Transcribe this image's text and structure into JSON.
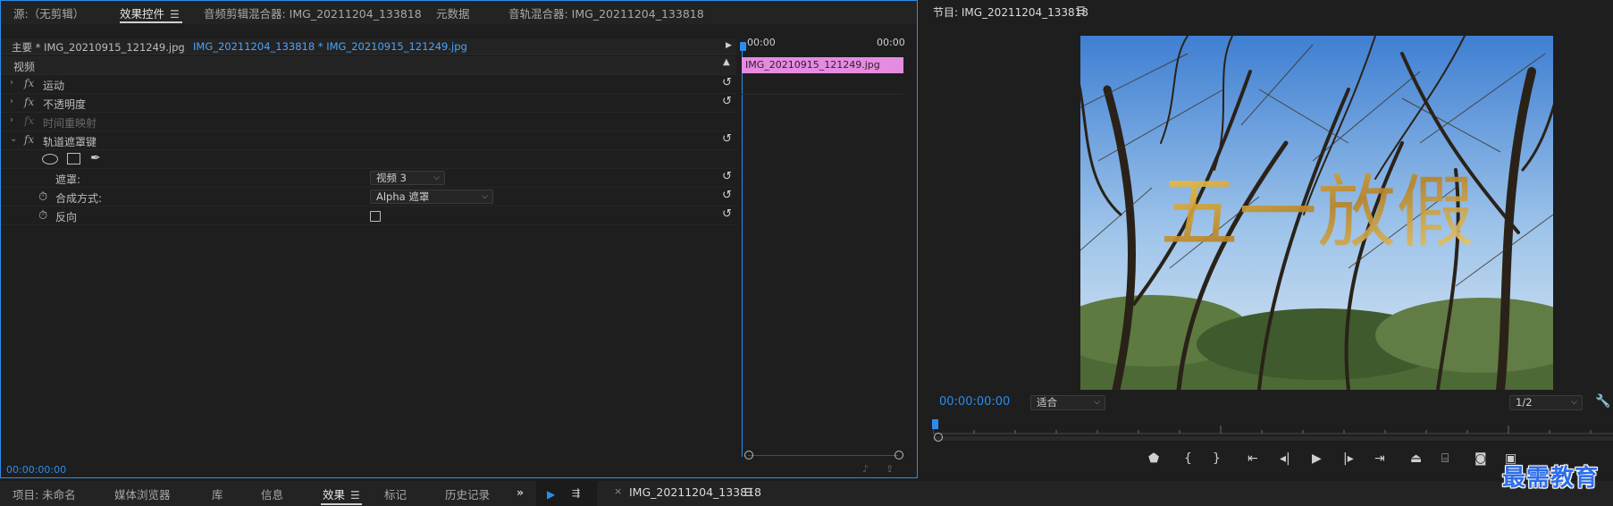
{
  "top_tabs": {
    "source": "源:（无剪辑）",
    "effect_controls": "效果控件",
    "audio_clip_mixer": "音频剪辑混合器: IMG_20211204_133818",
    "metadata": "元数据",
    "audio_track_mixer": "音轨混合器: IMG_20211204_133818"
  },
  "sequence": {
    "master": "主要 * IMG_20210915_121249.jpg",
    "clip": "IMG_20211204_133818 * IMG_20210915_121249.jpg"
  },
  "timeline": {
    "start_time": "00:00",
    "end_time": "00:00",
    "clip_name": "IMG_20210915_121249.jpg"
  },
  "section_video": "视频",
  "effects": [
    {
      "label": "运动",
      "enabled": true
    },
    {
      "label": "不透明度",
      "enabled": true
    },
    {
      "label": "时间重映射",
      "enabled": false
    },
    {
      "label": "轨道遮罩键",
      "enabled": true
    }
  ],
  "track_matte": {
    "matte_label": "遮罩:",
    "matte_value": "视频 3",
    "composite_label": "合成方式:",
    "composite_value": "Alpha 遮罩",
    "reverse_label": "反向"
  },
  "effect_timecode": "00:00:00:00",
  "program": {
    "title": "节目: IMG_20211204_133818",
    "timecode": "00:00:00:00",
    "fit": "适合",
    "resolution": "1/2",
    "overlay_text": "五一放假"
  },
  "bottom_tabs": {
    "project": "项目: 未命名",
    "media_browser": "媒体浏览器",
    "libraries": "库",
    "info": "信息",
    "effects": "效果",
    "markers": "标记",
    "history": "历史记录",
    "sequence_tab": "IMG_20211204_133818"
  },
  "watermark": "最需教育",
  "colors": {
    "accent": "#2d8ceb",
    "clip": "#e58be0"
  }
}
